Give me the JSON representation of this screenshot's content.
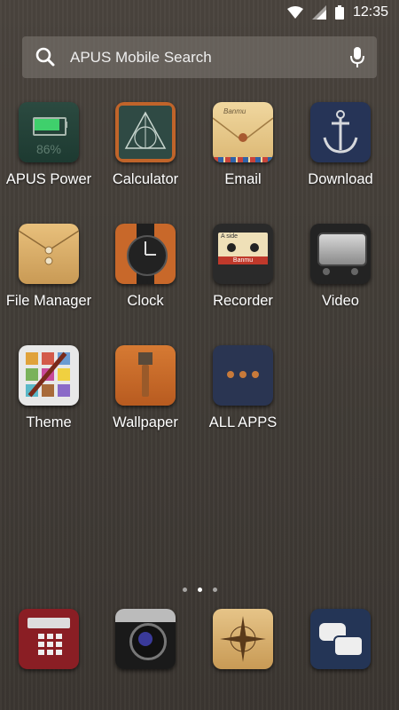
{
  "status": {
    "time": "12:35",
    "icons": [
      "wifi-icon",
      "signal-icon",
      "battery-icon"
    ]
  },
  "search": {
    "placeholder": "APUS Mobile Search"
  },
  "apps": [
    {
      "label": "APUS Power",
      "icon": "battery-icon",
      "battery_percent": "86%"
    },
    {
      "label": "Calculator",
      "icon": "calculator-icon"
    },
    {
      "label": "Email",
      "icon": "envelope-icon"
    },
    {
      "label": "Download",
      "icon": "anchor-icon"
    },
    {
      "label": "File Manager",
      "icon": "folder-icon"
    },
    {
      "label": "Clock",
      "icon": "watch-icon"
    },
    {
      "label": "Recorder",
      "icon": "cassette-icon",
      "tape_side": "A side",
      "tape_label": "Banmu"
    },
    {
      "label": "Video",
      "icon": "tv-icon"
    },
    {
      "label": "Theme",
      "icon": "palette-icon"
    },
    {
      "label": "Wallpaper",
      "icon": "paintbrush-icon"
    },
    {
      "label": "ALL APPS",
      "icon": "all-apps-icon"
    }
  ],
  "email_label": "Banmu",
  "pages": {
    "count": 3,
    "active": 1
  },
  "dock": [
    {
      "icon": "phone-icon"
    },
    {
      "icon": "camera-icon"
    },
    {
      "icon": "compass-icon"
    },
    {
      "icon": "messages-icon"
    }
  ]
}
